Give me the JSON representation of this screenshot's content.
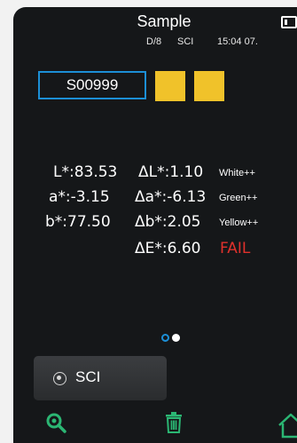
{
  "header": {
    "title": "Sample",
    "geometry": "D/8",
    "mode": "SCI",
    "datetime": "15:04 07."
  },
  "sample": {
    "id": "S00999"
  },
  "swatches": [
    "#f0c22a",
    "#f0c22a"
  ],
  "readings": {
    "L": "L*:83.53",
    "a": "a*:-3.15",
    "b": "b*:77.50",
    "dL": "ΔL*:1.10",
    "da": "Δa*:-6.13",
    "db": "Δb*:2.05",
    "dE": "ΔE*:6.60"
  },
  "descriptors": {
    "dL": "White++",
    "da": "Green++",
    "db": "Yellow++"
  },
  "result": "FAIL",
  "pager": {
    "pages": 2,
    "active": 1
  },
  "mode_button": {
    "label": "SCI"
  },
  "toolbar": {
    "icons": [
      "search-icon",
      "trash-icon",
      "home-icon"
    ]
  },
  "colors": {
    "background": "#151719",
    "accent": "#1c8fd6",
    "fail": "#e0312c",
    "swatch": "#f0c22a",
    "icon_green": "#2bb673"
  }
}
